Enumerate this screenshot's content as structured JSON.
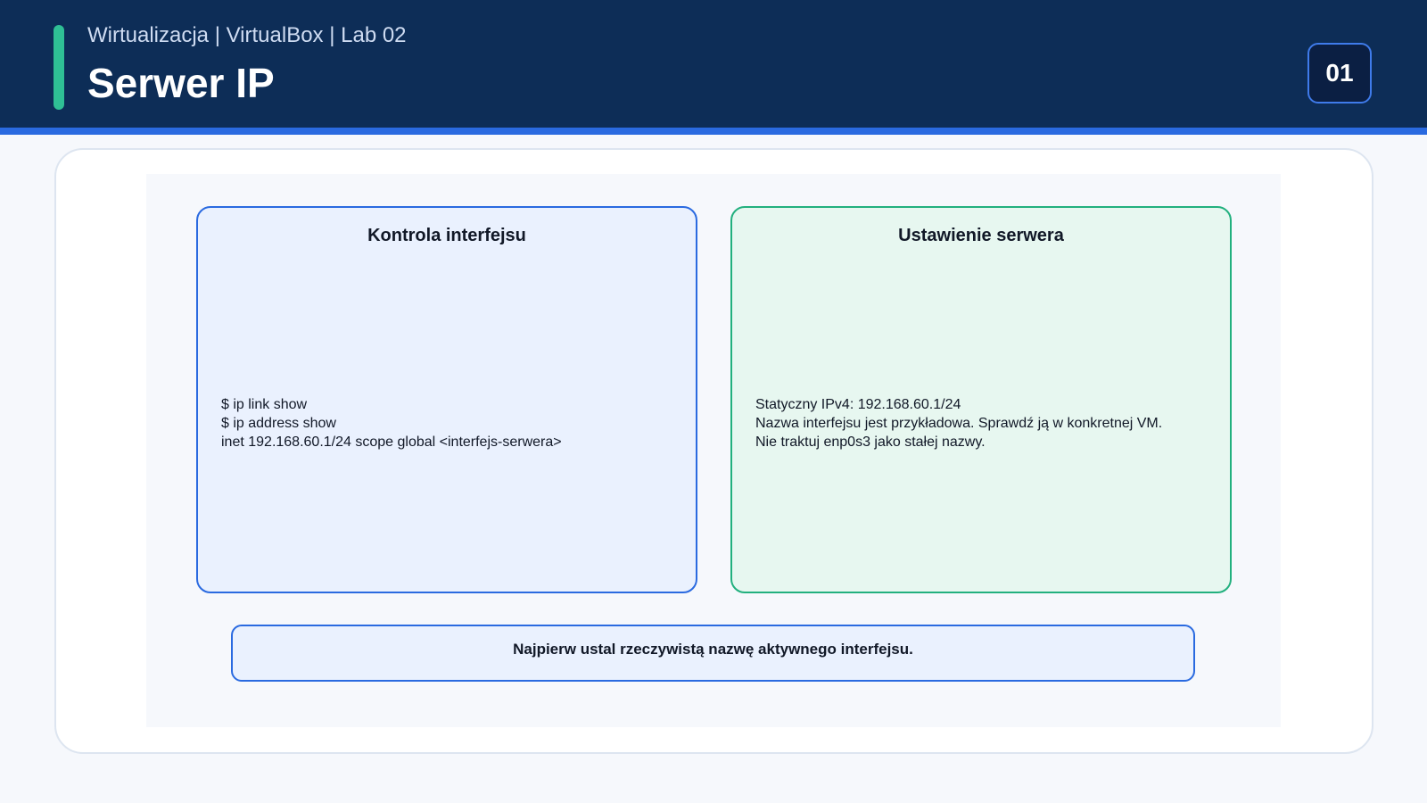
{
  "header": {
    "subtitle": "Wirtualizacja | VirtualBox | Lab 02",
    "title": "Serwer IP",
    "slide_number": "01"
  },
  "panels": [
    {
      "title": "Kontrola interfejsu",
      "lines": [
        "$ ip link show",
        "$ ip address show",
        "inet 192.168.60.1/24 scope global <interfejs-serwera>"
      ]
    },
    {
      "title": "Ustawienie serwera",
      "lines": [
        "Statyczny IPv4: 192.168.60.1/24",
        "Nazwa interfejsu jest przykładowa. Sprawdź ją w konkretnej VM.",
        "Nie traktuj enp0s3 jako stałej nazwy."
      ]
    }
  ],
  "note": {
    "text": "Najpierw ustal rzeczywistą nazwę aktywnego interfejsu."
  },
  "colors": {
    "header_bg": "#0d2d57",
    "accent_blue": "#2a6ae0",
    "accent_green": "#22b07e",
    "left_panel_bg": "#eaf1fe",
    "right_panel_bg": "#e7f7f0"
  }
}
